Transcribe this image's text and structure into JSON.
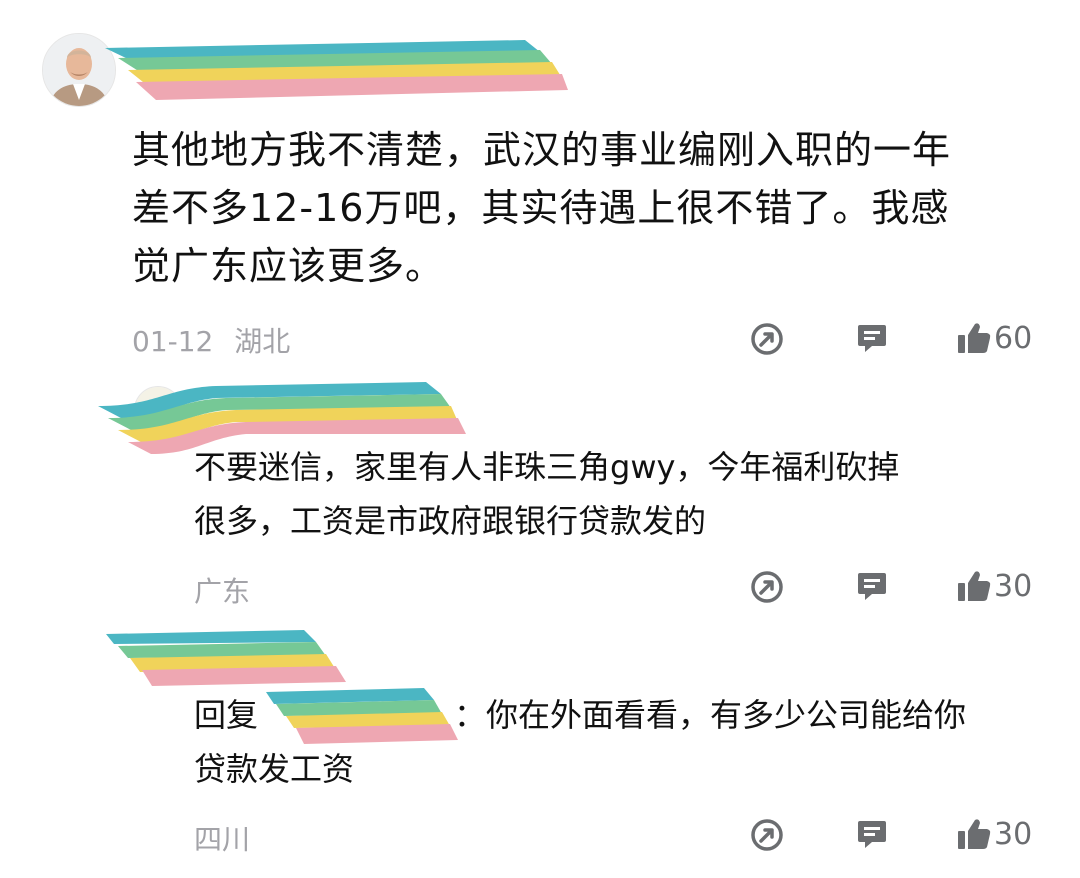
{
  "comments": [
    {
      "text": "其他地方我不清楚，武汉的事业编刚入职的一年差不多12-16万吧，其实待遇上很不错了。我感觉广东应该更多。",
      "text_lines": [
        "其他地方我不清楚，武汉的事业编刚入职的一年",
        "差不多12-16万吧，其实待遇上很不错了。我感",
        "觉广东应该更多。"
      ],
      "date": "01-12",
      "location": "湖北",
      "likes": "60",
      "avatar_icon": "user-avatar-photo"
    }
  ],
  "replies": [
    {
      "text_lines": [
        "不要迷信，家里有人非珠三角gwy，今年福利砍掉",
        "很多，工资是市政府跟银行贷款发的"
      ],
      "location": "广东",
      "likes": "30",
      "avatar_icon": "emoji-avatar"
    },
    {
      "reply_prefix": "回复",
      "reply_suffix": "：你在外面看看，有多少公司能给你",
      "line2": "贷款发工资",
      "location": "四川",
      "likes": "30"
    }
  ],
  "icons": {
    "share": "share-icon",
    "reply": "comment-icon",
    "like": "thumbs-up-icon"
  },
  "colors": {
    "meta_gray": "#a3a3a8",
    "icon_gray": "#6b6d70",
    "mention_blue": "#2a55d6"
  }
}
